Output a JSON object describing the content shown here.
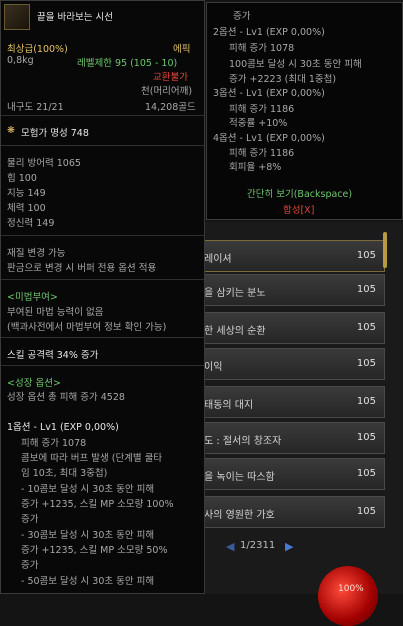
{
  "background_list": {
    "rows": [
      {
        "name": "레이셔",
        "level": "105"
      },
      {
        "name": "을 삼키는 분노",
        "level": "105"
      },
      {
        "name": "한 세상의 순환",
        "level": "105"
      },
      {
        "name": "이익",
        "level": "105"
      },
      {
        "name": "태동의 대지",
        "level": "105"
      },
      {
        "name": "도 : 절서의 창조자",
        "level": "105"
      },
      {
        "name": "을 녹이는 따스함",
        "level": "105"
      },
      {
        "name": "사의 영원한 가호",
        "level": "105"
      }
    ],
    "pager": "1/2311",
    "orb_label": "100%"
  },
  "tooltip_right": {
    "lines": [
      {
        "text": "증가",
        "color": "grey"
      },
      {
        "text": "2옵션 - Lv1 (EXP 0,00%)",
        "color": "grey"
      },
      {
        "text": "피해 증가 1078",
        "color": "grey"
      },
      {
        "text": "100콤보 달성 시 30초 동안 피해",
        "color": "grey"
      },
      {
        "text": "증가 +2223 (최대 1중첩)",
        "color": "grey"
      },
      {
        "text": "3옵션 - Lv1 (EXP 0,00%)",
        "color": "grey"
      },
      {
        "text": "피해 증가 1186",
        "color": "grey"
      },
      {
        "text": "적중률 +10%",
        "color": "grey"
      },
      {
        "text": "4옵션 - Lv1 (EXP 0,00%)",
        "color": "grey"
      },
      {
        "text": "피해 증가 1186",
        "color": "grey"
      },
      {
        "text": "회피율 +8%",
        "color": "grey"
      }
    ],
    "simple_view": "간단히 보기(Backspace)",
    "synth": "합성[X]"
  },
  "tooltip_left": {
    "item_name": "끝을 바라보는 시선",
    "grade": "최상급(100%)",
    "rarity": "에픽",
    "weight": "0,8kg",
    "level_limit": "레벨제한 95 (105 - 10)",
    "trade": "교환불가",
    "slot": "천(머리어깨)",
    "durability": "내구도 21/21",
    "price": "14,208골드",
    "fame": "모험가 명성 748",
    "stats": [
      "물리 방어력 1065",
      "힘 100",
      "지능 149",
      "체력 100",
      "정신력 149"
    ],
    "material_change": "재질 변경 가능",
    "material_note": "판금으로 변경 시 버퍼 전용 옵션 적용",
    "magic_seal_header": "<미법부여>",
    "magic_seal_1": "부여된 마법 능력이 없음",
    "magic_seal_2": "(백과사전에서 마법부여 정보 확인 가능)",
    "skill_atk": "스킬 공격력 34% 증가",
    "growth_header": "<성장 옵션>",
    "growth_total": "성장 옵션 총 피해 증가 4528",
    "option1_header": "1옵션 - Lv1 (EXP 0,00%)",
    "option1_lines": [
      "피해 증가 1078",
      "콤보에 따라 버프 발생 (단계별 쿨타",
      "임 10초, 최대 3중첩)",
      "- 10콤보 달성 시 30초 동안 피해",
      "증가 +1235, 스킬 MP 소모량 100%",
      "증가",
      "- 30콤보 달성 시 30초 동안 피해",
      "증가 +1235, 스킬 MP 소모량 50%",
      "증가",
      "- 50콤보 달성 시 30초 동안 피해"
    ]
  }
}
